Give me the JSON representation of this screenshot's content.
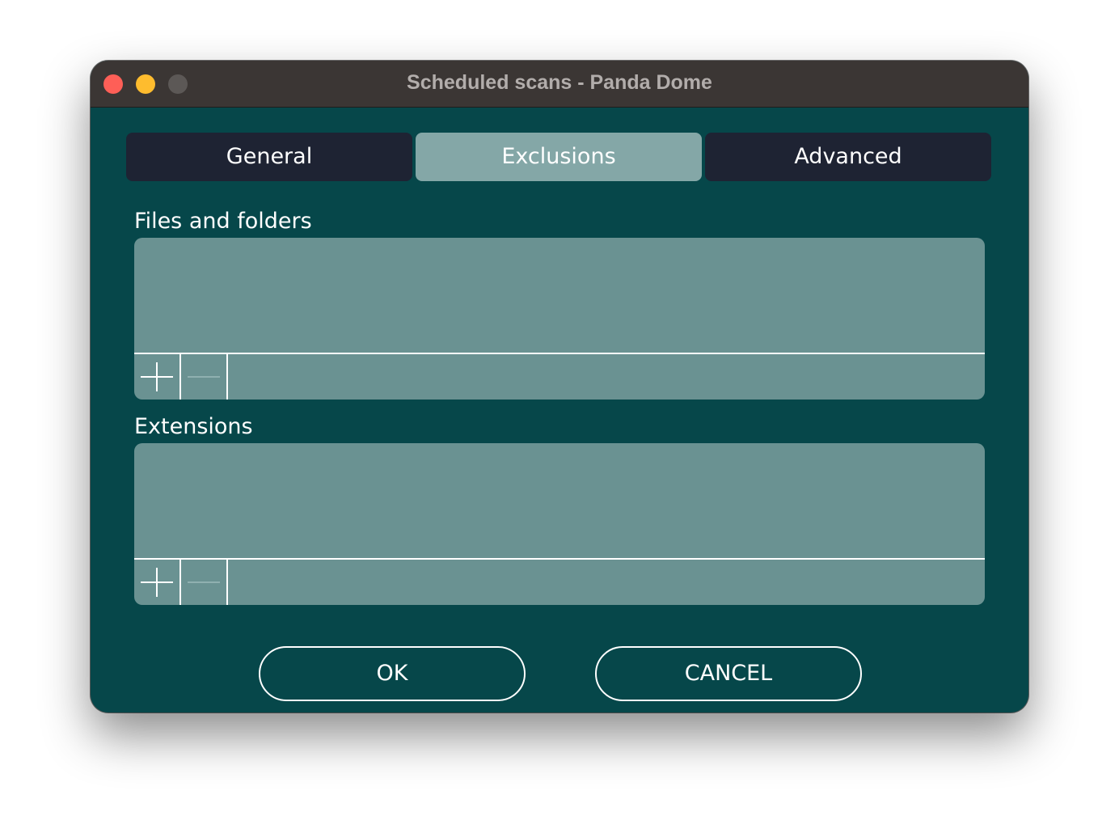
{
  "window": {
    "title": "Scheduled scans - Panda Dome"
  },
  "tabs": [
    {
      "label": "General",
      "selected": false
    },
    {
      "label": "Exclusions",
      "selected": true
    },
    {
      "label": "Advanced",
      "selected": false
    }
  ],
  "sections": {
    "files": {
      "label": "Files and folders",
      "items": []
    },
    "extensions": {
      "label": "Extensions",
      "items": []
    }
  },
  "buttons": {
    "ok": "OK",
    "cancel": "CANCEL"
  },
  "icons": {
    "add": "plus-icon",
    "remove": "minus-icon"
  },
  "colors": {
    "window_bg": "#06474a",
    "titlebar_bg": "#3b3634",
    "tab_bg": "#1e2333",
    "tab_selected_bg": "#84a7a7",
    "list_bg": "#6a9292",
    "close": "#fe5f57",
    "minimize": "#febc2e",
    "zoom_disabled": "#5c5856"
  }
}
